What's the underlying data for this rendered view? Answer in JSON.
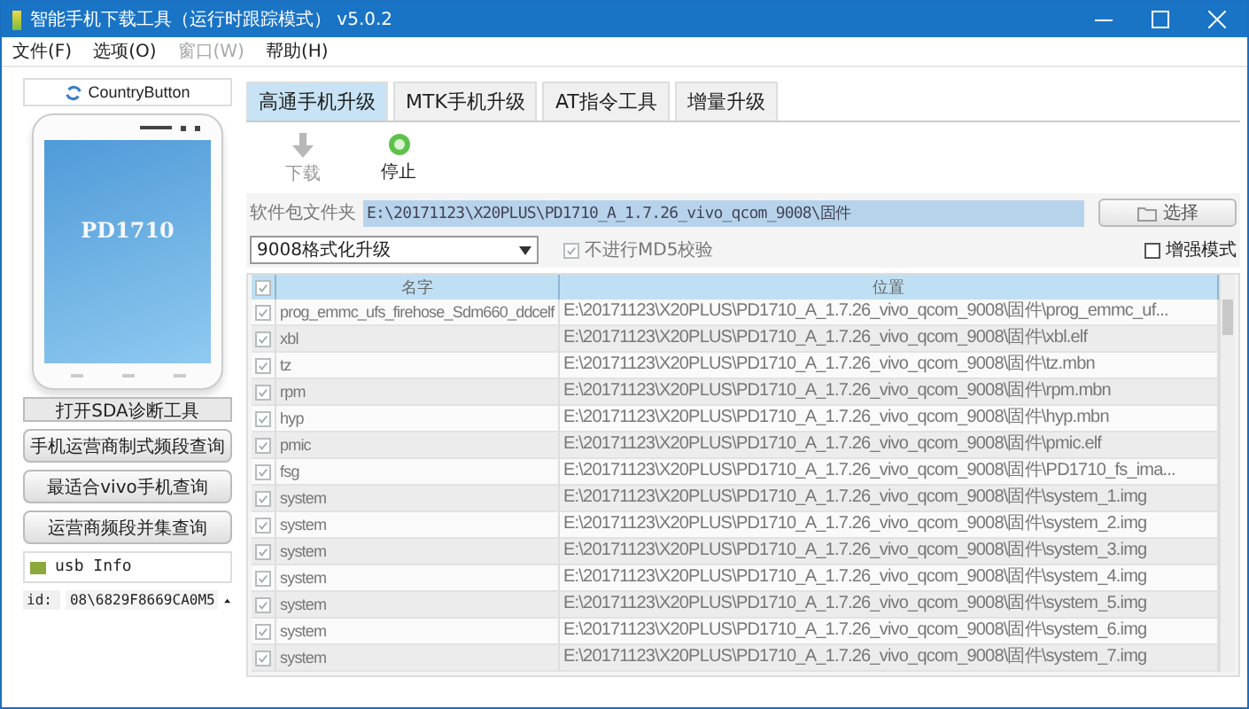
{
  "window": {
    "title": "智能手机下载工具（运行时跟踪模式） v5.0.2"
  },
  "menu": [
    {
      "label": "文件(F)",
      "disabled": false
    },
    {
      "label": "选项(O)",
      "disabled": false
    },
    {
      "label": "窗口(W)",
      "disabled": true
    },
    {
      "label": "帮助(H)",
      "disabled": false
    }
  ],
  "left_panel": {
    "country_button": "CountryButton",
    "phone_model": "PD1710",
    "buttons": [
      {
        "label": "打开SDA诊断工具",
        "kind": "flat"
      },
      {
        "label": "手机运营商制式频段查询",
        "kind": "raised"
      },
      {
        "label": "最适合vivo手机查询",
        "kind": "raised"
      },
      {
        "label": "运营商频段并集查询",
        "kind": "raised"
      }
    ],
    "usb_info": {
      "title": "usb Info",
      "fields": [
        {
          "label": "id:",
          "value": "08\\6829F8669CA0M5"
        }
      ]
    }
  },
  "tabs": [
    {
      "label": "高通手机升级",
      "selected": true
    },
    {
      "label": "MTK手机升级",
      "selected": false
    },
    {
      "label": "AT指令工具",
      "selected": false
    },
    {
      "label": "增量升级",
      "selected": false
    }
  ],
  "toolbar": [
    {
      "label": "下载",
      "kind": "download",
      "disabled": true
    },
    {
      "label": "停止",
      "kind": "stop",
      "disabled": false
    }
  ],
  "package": {
    "label": "软件包文件夹",
    "value": "E:\\20171123\\X20PLUS\\PD1710_A_1.7.26_vivo_qcom_9008\\固件",
    "button": "选择"
  },
  "mode_select": {
    "value": "9008格式化升级"
  },
  "options": [
    {
      "label": "不进行MD5校验",
      "checked": true,
      "disabled": true
    },
    {
      "label": "增强模式",
      "checked": false,
      "disabled": false
    }
  ],
  "table": {
    "all_checked": true,
    "columns": [
      "名字",
      "位置"
    ],
    "rows": [
      {
        "checked": true,
        "name": "prog_emmc_ufs_firehose_Sdm660_ddcelf",
        "path": "E:\\20171123\\X20PLUS\\PD1710_A_1.7.26_vivo_qcom_9008\\固件\\prog_emmc_uf..."
      },
      {
        "checked": true,
        "name": "xbl",
        "path": "E:\\20171123\\X20PLUS\\PD1710_A_1.7.26_vivo_qcom_9008\\固件\\xbl.elf"
      },
      {
        "checked": true,
        "name": "tz",
        "path": "E:\\20171123\\X20PLUS\\PD1710_A_1.7.26_vivo_qcom_9008\\固件\\tz.mbn"
      },
      {
        "checked": true,
        "name": "rpm",
        "path": "E:\\20171123\\X20PLUS\\PD1710_A_1.7.26_vivo_qcom_9008\\固件\\rpm.mbn"
      },
      {
        "checked": true,
        "name": "hyp",
        "path": "E:\\20171123\\X20PLUS\\PD1710_A_1.7.26_vivo_qcom_9008\\固件\\hyp.mbn"
      },
      {
        "checked": true,
        "name": "pmic",
        "path": "E:\\20171123\\X20PLUS\\PD1710_A_1.7.26_vivo_qcom_9008\\固件\\pmic.elf"
      },
      {
        "checked": true,
        "name": "fsg",
        "path": "E:\\20171123\\X20PLUS\\PD1710_A_1.7.26_vivo_qcom_9008\\固件\\PD1710_fs_ima..."
      },
      {
        "checked": true,
        "name": "system",
        "path": "E:\\20171123\\X20PLUS\\PD1710_A_1.7.26_vivo_qcom_9008\\固件\\system_1.img"
      },
      {
        "checked": true,
        "name": "system",
        "path": "E:\\20171123\\X20PLUS\\PD1710_A_1.7.26_vivo_qcom_9008\\固件\\system_2.img"
      },
      {
        "checked": true,
        "name": "system",
        "path": "E:\\20171123\\X20PLUS\\PD1710_A_1.7.26_vivo_qcom_9008\\固件\\system_3.img"
      },
      {
        "checked": true,
        "name": "system",
        "path": "E:\\20171123\\X20PLUS\\PD1710_A_1.7.26_vivo_qcom_9008\\固件\\system_4.img"
      },
      {
        "checked": true,
        "name": "system",
        "path": "E:\\20171123\\X20PLUS\\PD1710_A_1.7.26_vivo_qcom_9008\\固件\\system_5.img"
      },
      {
        "checked": true,
        "name": "system",
        "path": "E:\\20171123\\X20PLUS\\PD1710_A_1.7.26_vivo_qcom_9008\\固件\\system_6.img"
      },
      {
        "checked": true,
        "name": "system",
        "path": "E:\\20171123\\X20PLUS\\PD1710_A_1.7.26_vivo_qcom_9008\\固件\\system_7.img"
      }
    ]
  }
}
